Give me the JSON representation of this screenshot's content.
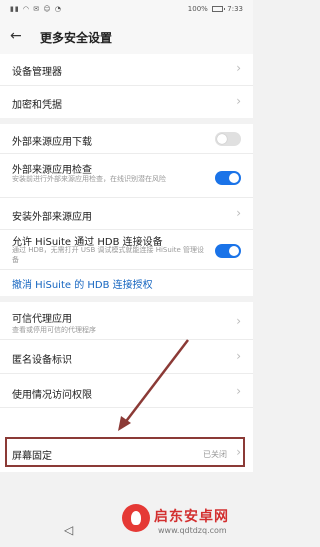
{
  "status_bar": {
    "battery": "100%",
    "time": "7:33"
  },
  "header": {
    "back_glyph": "←",
    "title": "更多安全设置"
  },
  "group1": [
    {
      "label": "设备管理器"
    },
    {
      "label": "加密和凭据"
    }
  ],
  "group2": {
    "external_download": {
      "label": "外部来源应用下载",
      "enabled": false
    },
    "external_check": {
      "label": "外部来源应用检查",
      "desc": "安装前进行外部来源应用检查，在线识别潜在风险",
      "enabled": true
    },
    "install_external": {
      "label": "安装外部来源应用"
    },
    "hisuite_hdb": {
      "label": "允许 HiSuite 通过 HDB 连接设备",
      "desc": "通过 HDB，无需打开 USB 调试模式就能连接 HiSuite 管理设备",
      "enabled": true
    },
    "revoke": {
      "label": "撤消 HiSuite 的 HDB 连接授权"
    }
  },
  "group3": {
    "trust_agent": {
      "label": "可信代理应用",
      "desc": "查看或停用可信的代理程序"
    },
    "anon_id": {
      "label": "匿名设备标识"
    },
    "usage_access": {
      "label": "使用情况访问权限"
    },
    "screen_pin": {
      "label": "屏幕固定",
      "value": "已关闭"
    }
  },
  "chevron": "›",
  "nav": {
    "back_glyph": "◁"
  },
  "watermark": {
    "title": "启东安卓网",
    "url": "www.qdtdzq.com"
  },
  "colors": {
    "accent": "#1a73e8",
    "link": "#1565c0",
    "highlight": "#8b3a36",
    "watermark": "#d32f2f"
  }
}
